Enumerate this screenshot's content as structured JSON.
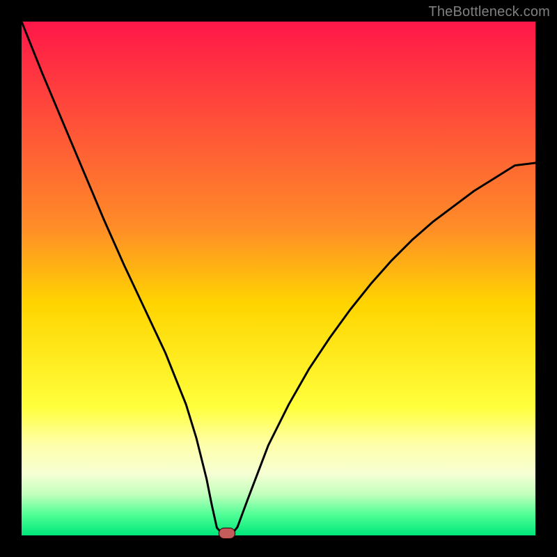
{
  "watermark": "TheBottleneck.com",
  "colors": {
    "frame": "#000000",
    "watermark": "#808080",
    "curve": "#000000",
    "marker_fill": "#c55c5c",
    "marker_border": "#3a0a0a"
  },
  "chart_data": {
    "type": "line",
    "title": "",
    "xlabel": "",
    "ylabel": "",
    "xlim": [
      0,
      100
    ],
    "ylim": [
      0,
      100
    ],
    "grid": false,
    "series": [
      {
        "name": "curve",
        "x": [
          0,
          4,
          8,
          12,
          16,
          20,
          24,
          28,
          32,
          34,
          36,
          37,
          38,
          39,
          40,
          41,
          42,
          44,
          48,
          52,
          56,
          60,
          64,
          68,
          72,
          76,
          80,
          84,
          88,
          92,
          96,
          100
        ],
        "values": [
          100,
          90,
          80.5,
          71,
          61.5,
          52.5,
          44,
          35.5,
          25.5,
          19,
          11,
          6,
          1.5,
          0.4,
          0.4,
          0.4,
          1.6,
          7,
          17.5,
          25.5,
          32.5,
          38.5,
          44,
          49,
          53.5,
          57.5,
          61,
          64,
          67,
          69.5,
          72,
          72.5
        ]
      }
    ],
    "annotations": [
      {
        "name": "marker",
        "x": 40,
        "y": 0.4
      }
    ]
  }
}
